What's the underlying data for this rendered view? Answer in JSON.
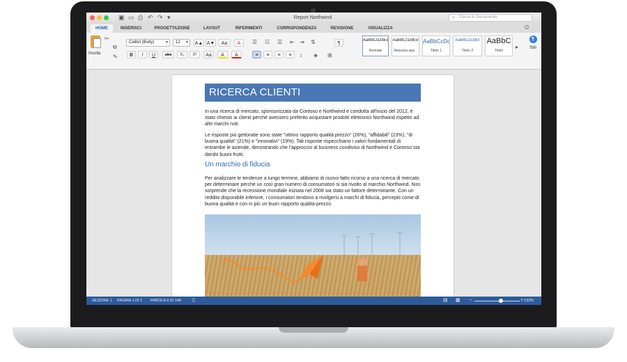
{
  "window": {
    "title": "Report Northwind"
  },
  "search": {
    "placeholder": "Cerca in Documento"
  },
  "tabs": [
    {
      "label": "HOME"
    },
    {
      "label": "INSERISCI"
    },
    {
      "label": "PROGETTAZIONE"
    },
    {
      "label": "LAYOUT"
    },
    {
      "label": "RIFERIMENTI"
    },
    {
      "label": "CORRISPONDENZA"
    },
    {
      "label": "REVISIONE"
    },
    {
      "label": "VISUALIZZA"
    }
  ],
  "ribbon": {
    "paste_label": "Incolla",
    "font_name": "Calibri (Body)",
    "font_size": "12",
    "bold": "B",
    "italic": "I",
    "underline": "U",
    "strike": "abc",
    "subscript": "X₂",
    "superscript": "X²",
    "grow_font": "A▲",
    "shrink_font": "A▼",
    "change_case": "Aa",
    "clear_format": "A",
    "highlight": "A",
    "font_color": "A",
    "pilcrow": "¶",
    "styles": [
      {
        "sample": "AaBbCcDdEe",
        "name": "Normale"
      },
      {
        "sample": "AaBbCcDdEe",
        "name": "Nessuna spa..."
      },
      {
        "sample": "AaBbCcDc",
        "name": "Titolo 1"
      },
      {
        "sample": "AaBbCcDdEt",
        "name": "Titolo 2"
      },
      {
        "sample": "AaBbC",
        "name": "Titolo"
      }
    ],
    "stili_label": "Stili"
  },
  "document": {
    "heading": "RICERCA CLIENTI",
    "para1": "In una ricerca di mercato, sponsorizzata da Contoso e Northwind e condotta all'inizio del 2012, è stato chiesto ai clienti perché avessero preferito acquistare prodotti elettronici Northwind rispetto ad altri marchi noti.",
    "para2": "Le risposte più gettonate sono state \"ottimo rapporto qualità prezzo\" (26%), \"affidabili\" (23%), \"di buona qualità\" (21%) e \"innovativi\" (19%). Tali risposte rispecchiano i valori fondamentali di entrambe le aziende, dimostrando che l'approccio al business condiviso di Northwind e Contoso sta dando buoni frutti.",
    "subheading": "Un marchio di fiducia",
    "para3": "Per analizzare le tendenze a lungo termine, abbiamo di nuovo fatto ricorso a una ricerca di mercato per determinare perché un così gran numero di consumatori si sia rivolto al marchio Northwind. Non sorprende che la recessione mondiale iniziata nel 2008 sia stato un fattore determinante. Con un reddito disponibile inferiore, i consumatori tendono a rivolgersi a marchi di fiducia, percepiti come di buona qualità e con in più un buon rapporto qualità-prezzo."
  },
  "status": {
    "section": "SEZIONE 1",
    "page": "PAGINA 1 DI 1",
    "words": "PAROLA 0 DI 148",
    "zoom": "132%"
  },
  "colors": {
    "heading_bg": "#4a78b4",
    "accent": "#2e67b2",
    "status_bar": "#2d5b9b"
  }
}
